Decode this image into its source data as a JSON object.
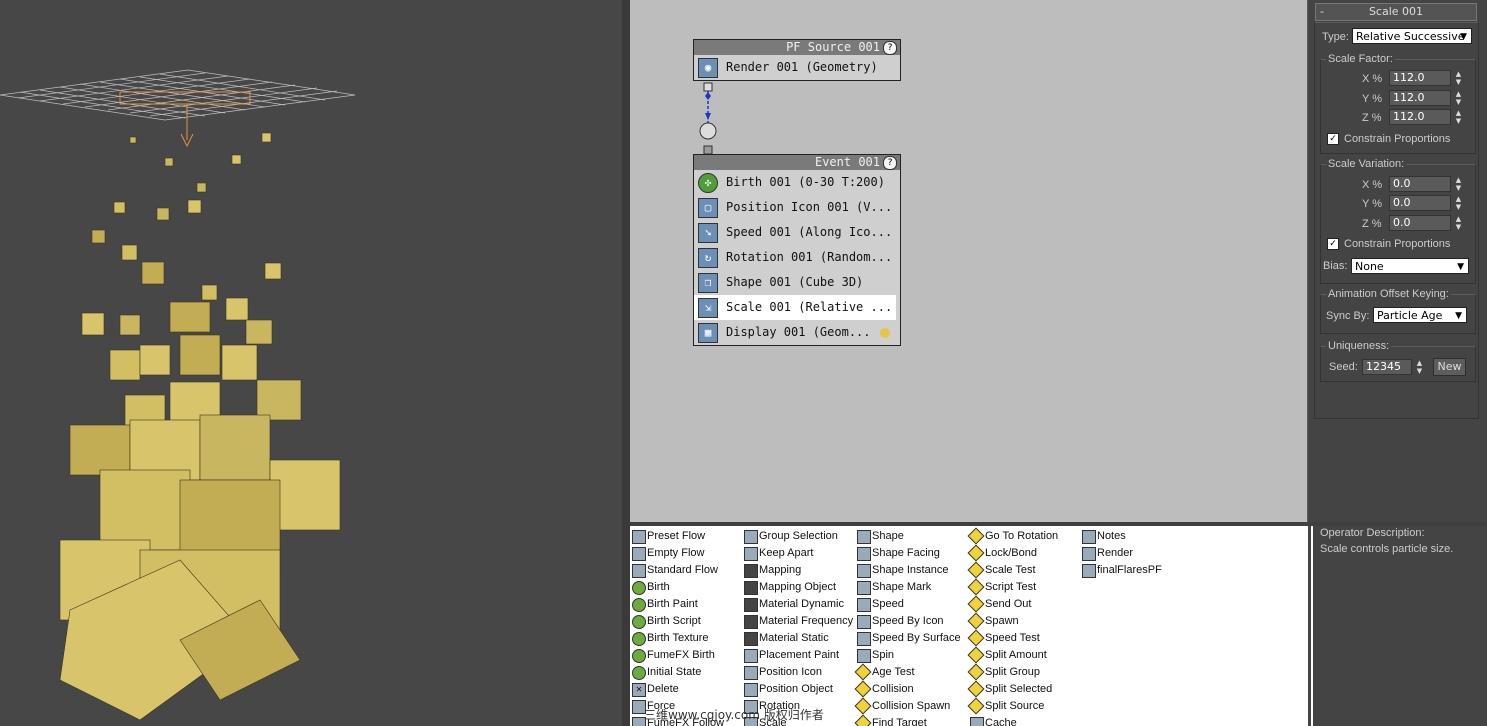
{
  "flow": {
    "source_node": {
      "title": "PF Source 001",
      "ops": [
        {
          "label": "Render 001 (Geometry)",
          "icon": "render-icon"
        }
      ]
    },
    "event_node": {
      "title": "Event 001",
      "ops": [
        {
          "label": "Birth 001 (0-30 T:200)",
          "icon": "birth-icon"
        },
        {
          "label": "Position Icon 001 (V...",
          "icon": "position-icon"
        },
        {
          "label": "Speed 001 (Along Ico...",
          "icon": "speed-icon"
        },
        {
          "label": "Rotation 001 (Random...",
          "icon": "rotation-icon"
        },
        {
          "label": "Shape 001 (Cube 3D)",
          "icon": "shape-icon"
        },
        {
          "label": "Scale 001 (Relative ...",
          "icon": "scale-icon"
        },
        {
          "label": "Display 001 (Geom...",
          "icon": "display-icon"
        }
      ]
    }
  },
  "depot": {
    "col1": [
      "Preset Flow",
      "Empty Flow",
      "Standard Flow",
      "Birth",
      "Birth Paint",
      "Birth Script",
      "Birth Texture",
      "FumeFX Birth",
      "Initial State",
      "Delete",
      "Force",
      "FumeFX Follow"
    ],
    "col2": [
      "Group Selection",
      "Keep Apart",
      "Mapping",
      "Mapping Object",
      "Material Dynamic",
      "Material Frequency",
      "Material Static",
      "Placement Paint",
      "Position Icon",
      "Position Object",
      "Rotation",
      "Scale"
    ],
    "col3": [
      "Shape",
      "Shape Facing",
      "Shape Instance",
      "Shape Mark",
      "Speed",
      "Speed By Icon",
      "Speed By Surface",
      "Spin",
      "Age Test",
      "Collision",
      "Collision Spawn",
      "Find Target"
    ],
    "col4": [
      "Go To Rotation",
      "Lock/Bond",
      "Scale Test",
      "Script Test",
      "Send Out",
      "Spawn",
      "Speed Test",
      "Split Amount",
      "Split Group",
      "Split Selected",
      "Split Source",
      "Cache"
    ],
    "col5": [
      "Notes",
      "Render",
      "finalFlaresPF"
    ]
  },
  "watermark": "三维www.cgjoy.com 版权归作者",
  "description": {
    "title": "Operator Description:",
    "text": "Scale controls particle size."
  },
  "rollout": {
    "toggle": "-",
    "title": "Scale 001",
    "type_label": "Type:",
    "type_value": "Relative Successive",
    "scale_factor_label": "Scale Factor:",
    "factor": [
      {
        "axis": "X %",
        "value": "112.0"
      },
      {
        "axis": "Y %",
        "value": "112.0"
      },
      {
        "axis": "Z %",
        "value": "112.0"
      }
    ],
    "constrain_label": "Constrain Proportions",
    "scale_variation_label": "Scale Variation:",
    "variation": [
      {
        "axis": "X %",
        "value": "0.0"
      },
      {
        "axis": "Y %",
        "value": "0.0"
      },
      {
        "axis": "Z %",
        "value": "0.0"
      }
    ],
    "bias_label": "Bias:",
    "bias_value": "None",
    "anim_label": "Animation Offset Keying:",
    "sync_label": "Sync By:",
    "sync_value": "Particle Age",
    "uniq_label": "Uniqueness:",
    "seed_label": "Seed:",
    "seed_value": "12345",
    "new_label": "New"
  }
}
